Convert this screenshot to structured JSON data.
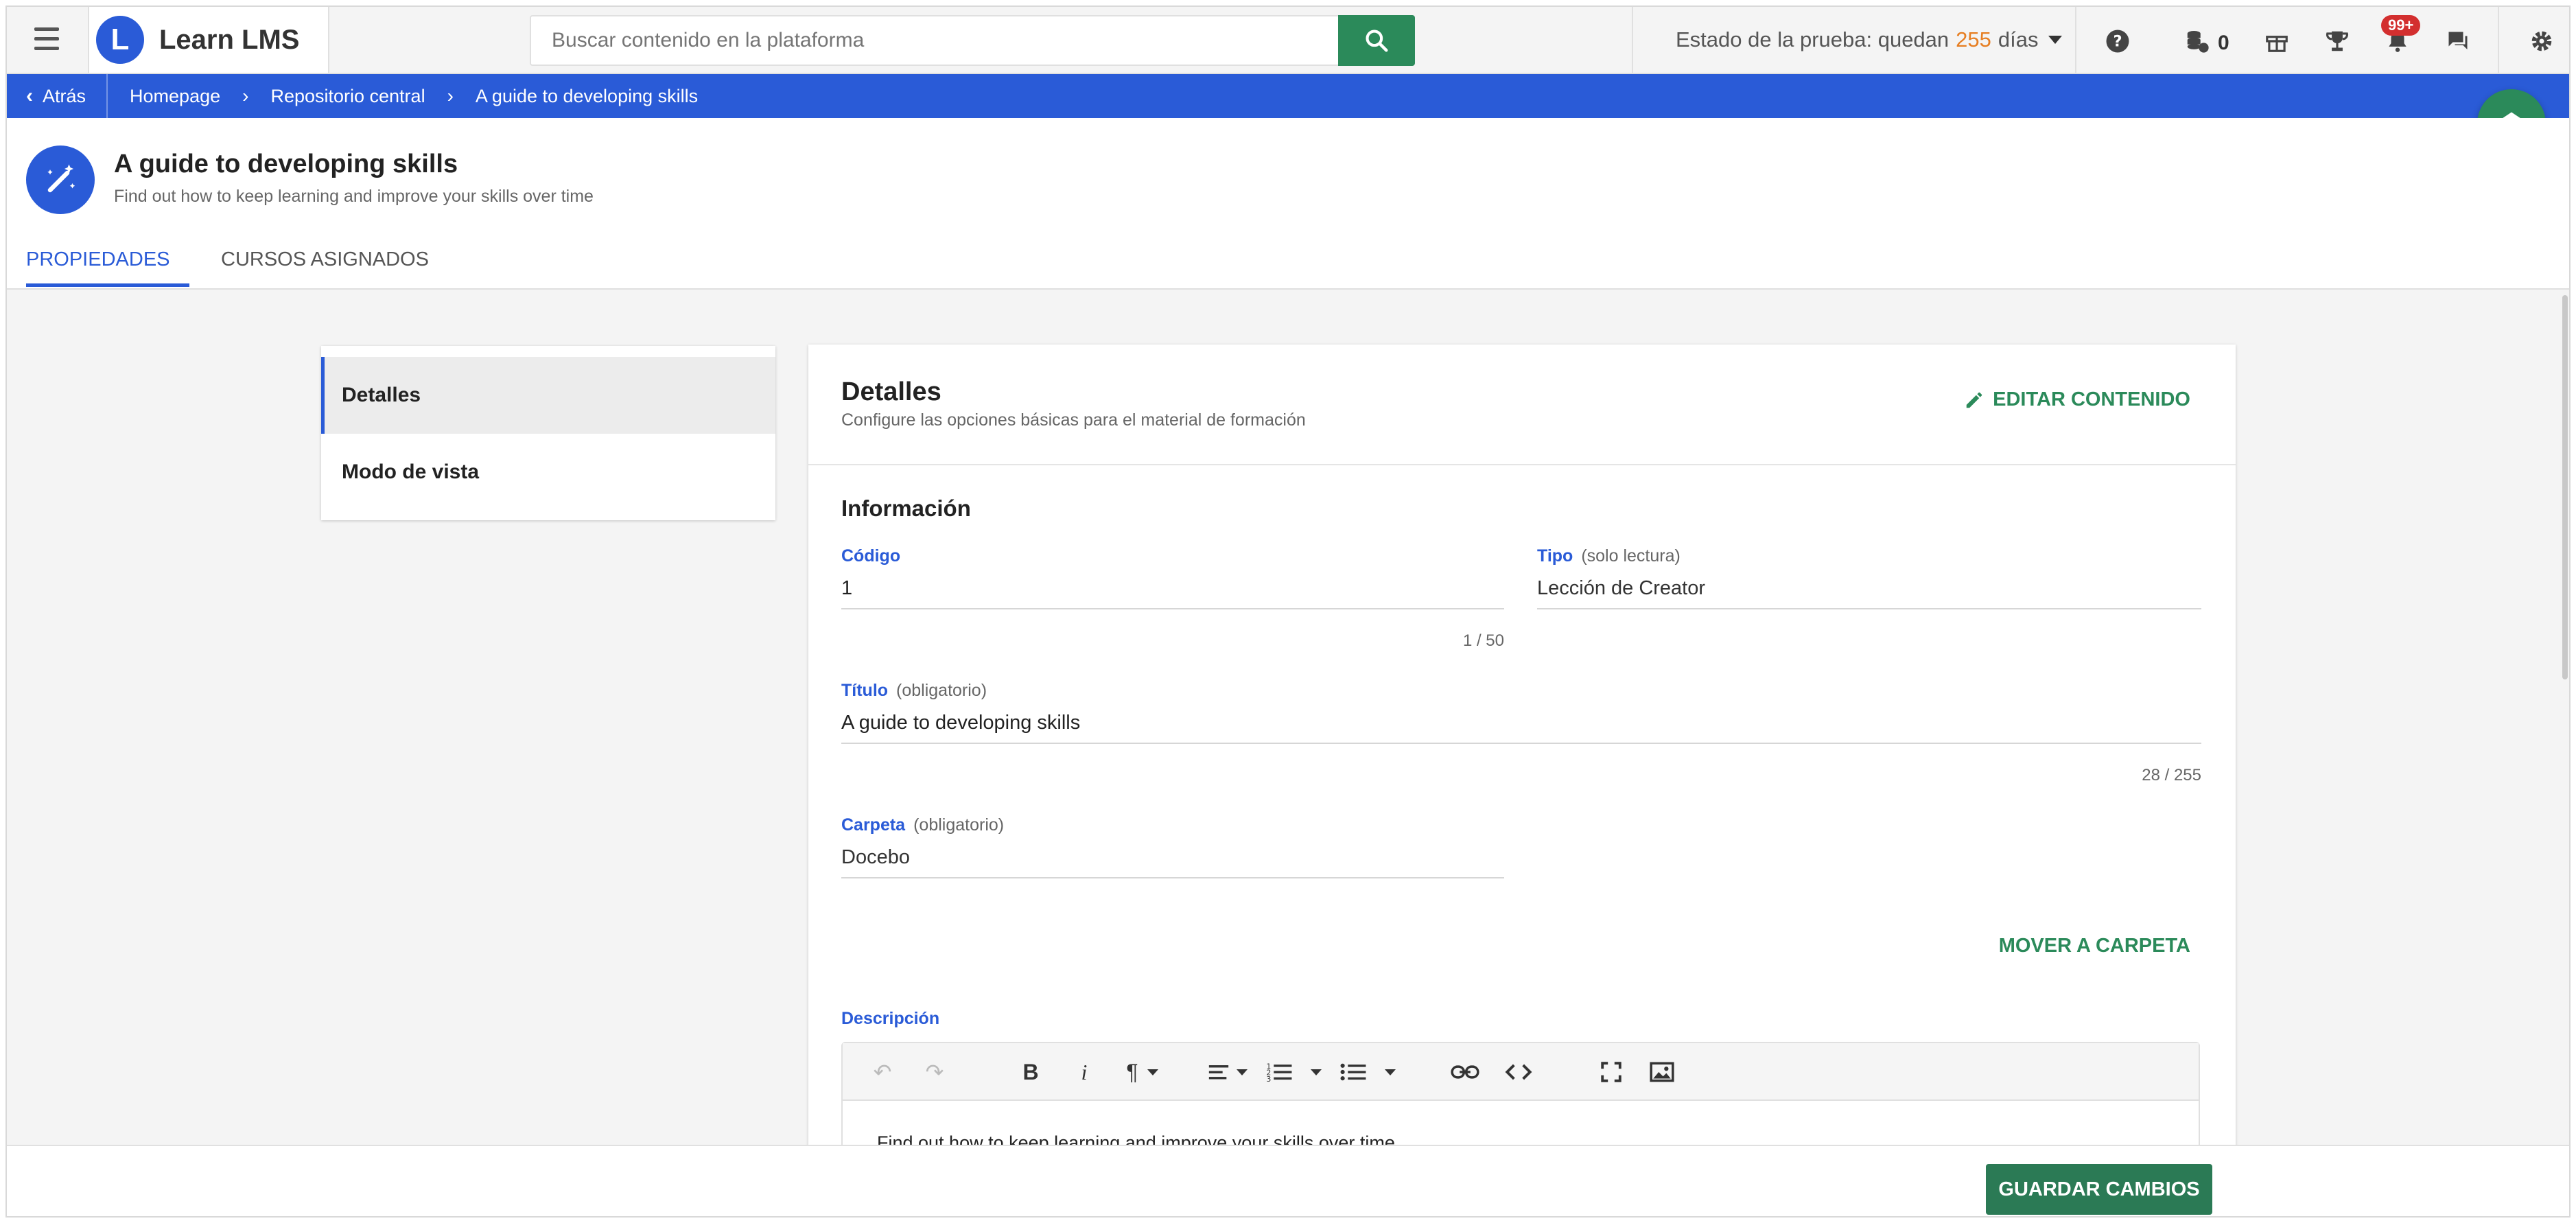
{
  "app": {
    "name": "Learn LMS",
    "logo_letter": "L"
  },
  "search": {
    "placeholder": "Buscar contenido en la plataforma"
  },
  "trial": {
    "prefix": "Estado de la prueba: quedan",
    "days": "255",
    "suffix": "días"
  },
  "topbar": {
    "coins_count": "0",
    "notifications_badge": "99+",
    "icons": [
      "help-icon",
      "coins-icon",
      "gift-icon",
      "trophy-icon",
      "bell-icon",
      "chat-icon",
      "settings-icon"
    ]
  },
  "breadcrumb": {
    "back_label": "Atrás",
    "items": [
      "Homepage",
      "Repositorio central",
      "A guide to developing skills"
    ]
  },
  "header": {
    "title": "A guide to developing skills",
    "subtitle": "Find out how to keep learning and improve your skills over time",
    "tabs": [
      {
        "label": "PROPIEDADES",
        "active": true
      },
      {
        "label": "CURSOS ASIGNADOS",
        "active": false
      }
    ]
  },
  "side_menu": {
    "items": [
      {
        "label": "Detalles",
        "active": true
      },
      {
        "label": "Modo de vista",
        "active": false
      }
    ]
  },
  "card": {
    "title": "Detalles",
    "subtitle": "Configure las opciones básicas para el material de formación",
    "edit_label": "EDITAR CONTENIDO",
    "section_title": "Información",
    "fields": {
      "codigo": {
        "label": "Código",
        "value": "1",
        "counter": "1 / 50"
      },
      "tipo": {
        "label": "Tipo",
        "note": "(solo lectura)",
        "value": "Lección de Creator"
      },
      "titulo": {
        "label": "Título",
        "note": "(obligatorio)",
        "value": "A guide to developing skills",
        "counter": "28 / 255"
      },
      "carpeta": {
        "label": "Carpeta",
        "note": "(obligatorio)",
        "value": "Docebo"
      }
    },
    "move_label": "MOVER A CARPETA",
    "description": {
      "label": "Descripción",
      "text": "Find out how to keep learning and improve your skills over time"
    }
  },
  "footer": {
    "save_label": "GUARDAR CAMBIOS"
  },
  "colors": {
    "primary_blue": "#2a5bd7",
    "green": "#2b8a5a",
    "trial_days": "#e67e22",
    "badge_red": "#d32f2f"
  }
}
